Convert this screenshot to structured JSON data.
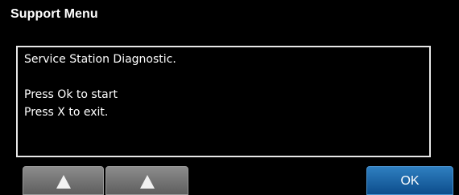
{
  "window": {
    "title": "Support Menu"
  },
  "message": {
    "lines": [
      "Service Station Diagnostic.",
      "",
      "Press Ok to start",
      "Press X to exit."
    ]
  },
  "softkeys": {
    "up_1_icon": "up-arrow-icon",
    "up_2_icon": "up-arrow-icon",
    "ok_label": "OK"
  },
  "colors": {
    "background": "#000000",
    "text": "#ffffff",
    "softkey_grey": "#7a7a7a",
    "ok_blue": "#1b66a8"
  }
}
